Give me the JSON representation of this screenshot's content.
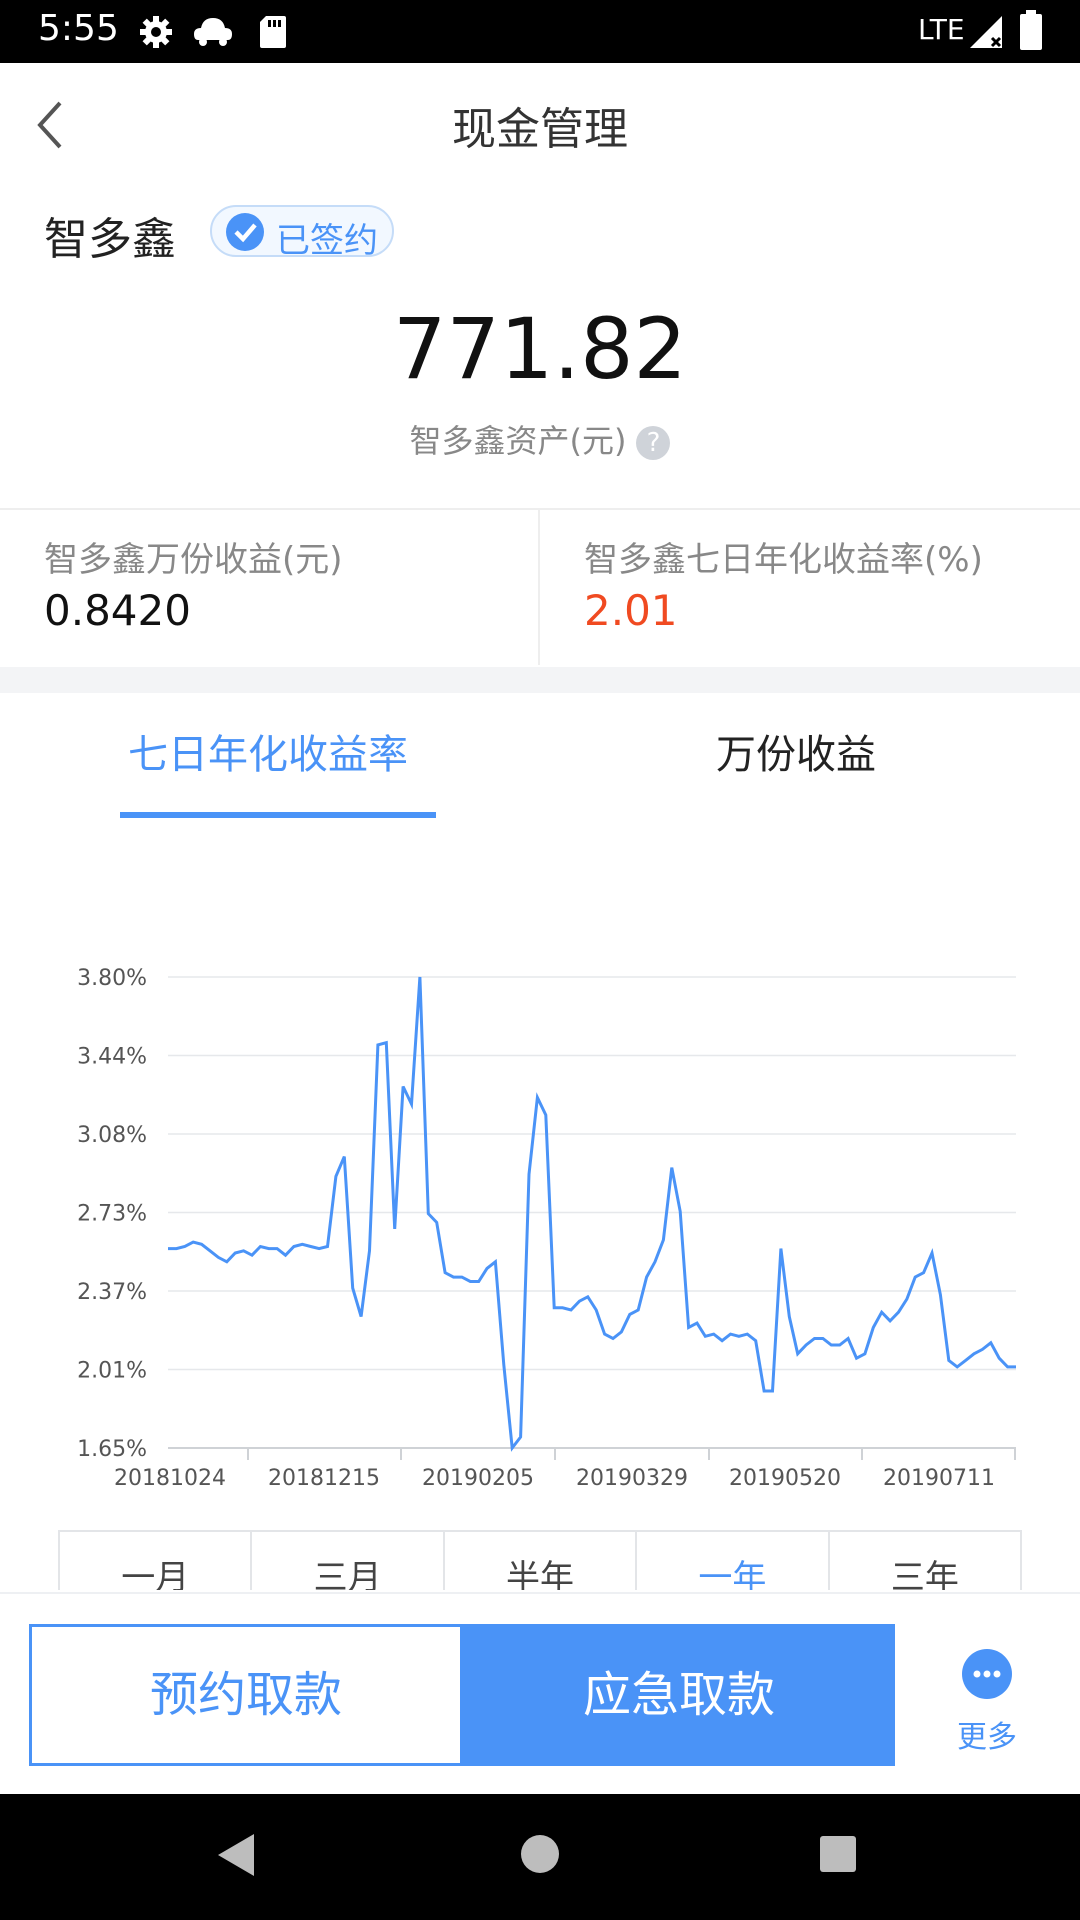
{
  "status_bar": {
    "time": "5:55",
    "network": "LTE",
    "icons": [
      "settings-gear-icon",
      "cloud-car-icon",
      "sd-card-icon",
      "signal-icon",
      "battery-icon"
    ]
  },
  "header": {
    "title": "现金管理",
    "back_icon": "chevron-left-icon"
  },
  "account": {
    "name": "智多鑫",
    "badge_label": "已签约",
    "amount": "771.82",
    "amount_label": "智多鑫资产(元)",
    "help_icon": "?"
  },
  "stats": {
    "left": {
      "label": "智多鑫万份收益(元)",
      "value": "0.8420"
    },
    "right": {
      "label": "智多鑫七日年化收益率(%)",
      "value": "2.01"
    }
  },
  "tabs": [
    {
      "label": "七日年化收益率",
      "active": true
    },
    {
      "label": "万份收益",
      "active": false
    }
  ],
  "periods": [
    {
      "label": "一月",
      "active": false
    },
    {
      "label": "三月",
      "active": false
    },
    {
      "label": "半年",
      "active": false
    },
    {
      "label": "一年",
      "active": true
    },
    {
      "label": "三年",
      "active": false
    }
  ],
  "actions": {
    "book_withdraw": "预约取款",
    "emergency_withdraw": "应急取款",
    "more": "更多"
  },
  "colors": {
    "accent": "#4a93f7",
    "positive_rate": "#f04a21",
    "chart_line": "#4a93f7"
  },
  "chart_data": {
    "type": "line",
    "title": "",
    "xlabel": "",
    "ylabel": "",
    "x_ticks": [
      "20181024",
      "20181215",
      "20190205",
      "20190329",
      "20190520",
      "20190711"
    ],
    "y_ticks": [
      "1.65%",
      "2.01%",
      "2.37%",
      "2.73%",
      "3.08%",
      "3.44%",
      "3.80%"
    ],
    "ylim": [
      1.65,
      3.8
    ],
    "grid": true,
    "series": [
      {
        "name": "",
        "values": [
          2.56,
          2.56,
          2.57,
          2.59,
          2.58,
          2.55,
          2.52,
          2.5,
          2.54,
          2.55,
          2.53,
          2.57,
          2.56,
          2.56,
          2.53,
          2.57,
          2.58,
          2.57,
          2.56,
          2.57,
          2.89,
          2.98,
          2.38,
          2.25,
          2.55,
          3.49,
          3.5,
          2.65,
          3.3,
          3.22,
          3.8,
          2.72,
          2.68,
          2.45,
          2.43,
          2.43,
          2.41,
          2.41,
          2.47,
          2.5,
          2.03,
          1.65,
          1.7,
          2.9,
          3.25,
          3.17,
          2.29,
          2.29,
          2.28,
          2.32,
          2.34,
          2.28,
          2.17,
          2.15,
          2.18,
          2.26,
          2.28,
          2.43,
          2.5,
          2.6,
          2.93,
          2.73,
          2.2,
          2.22,
          2.16,
          2.17,
          2.14,
          2.17,
          2.16,
          2.17,
          2.14,
          1.91,
          1.91,
          2.56,
          2.25,
          2.08,
          2.12,
          2.15,
          2.15,
          2.12,
          2.12,
          2.15,
          2.06,
          2.08,
          2.2,
          2.27,
          2.23,
          2.27,
          2.33,
          2.43,
          2.45,
          2.54,
          2.35,
          2.05,
          2.02,
          2.05,
          2.08,
          2.1,
          2.13,
          2.06,
          2.02,
          2.02
        ]
      }
    ]
  }
}
